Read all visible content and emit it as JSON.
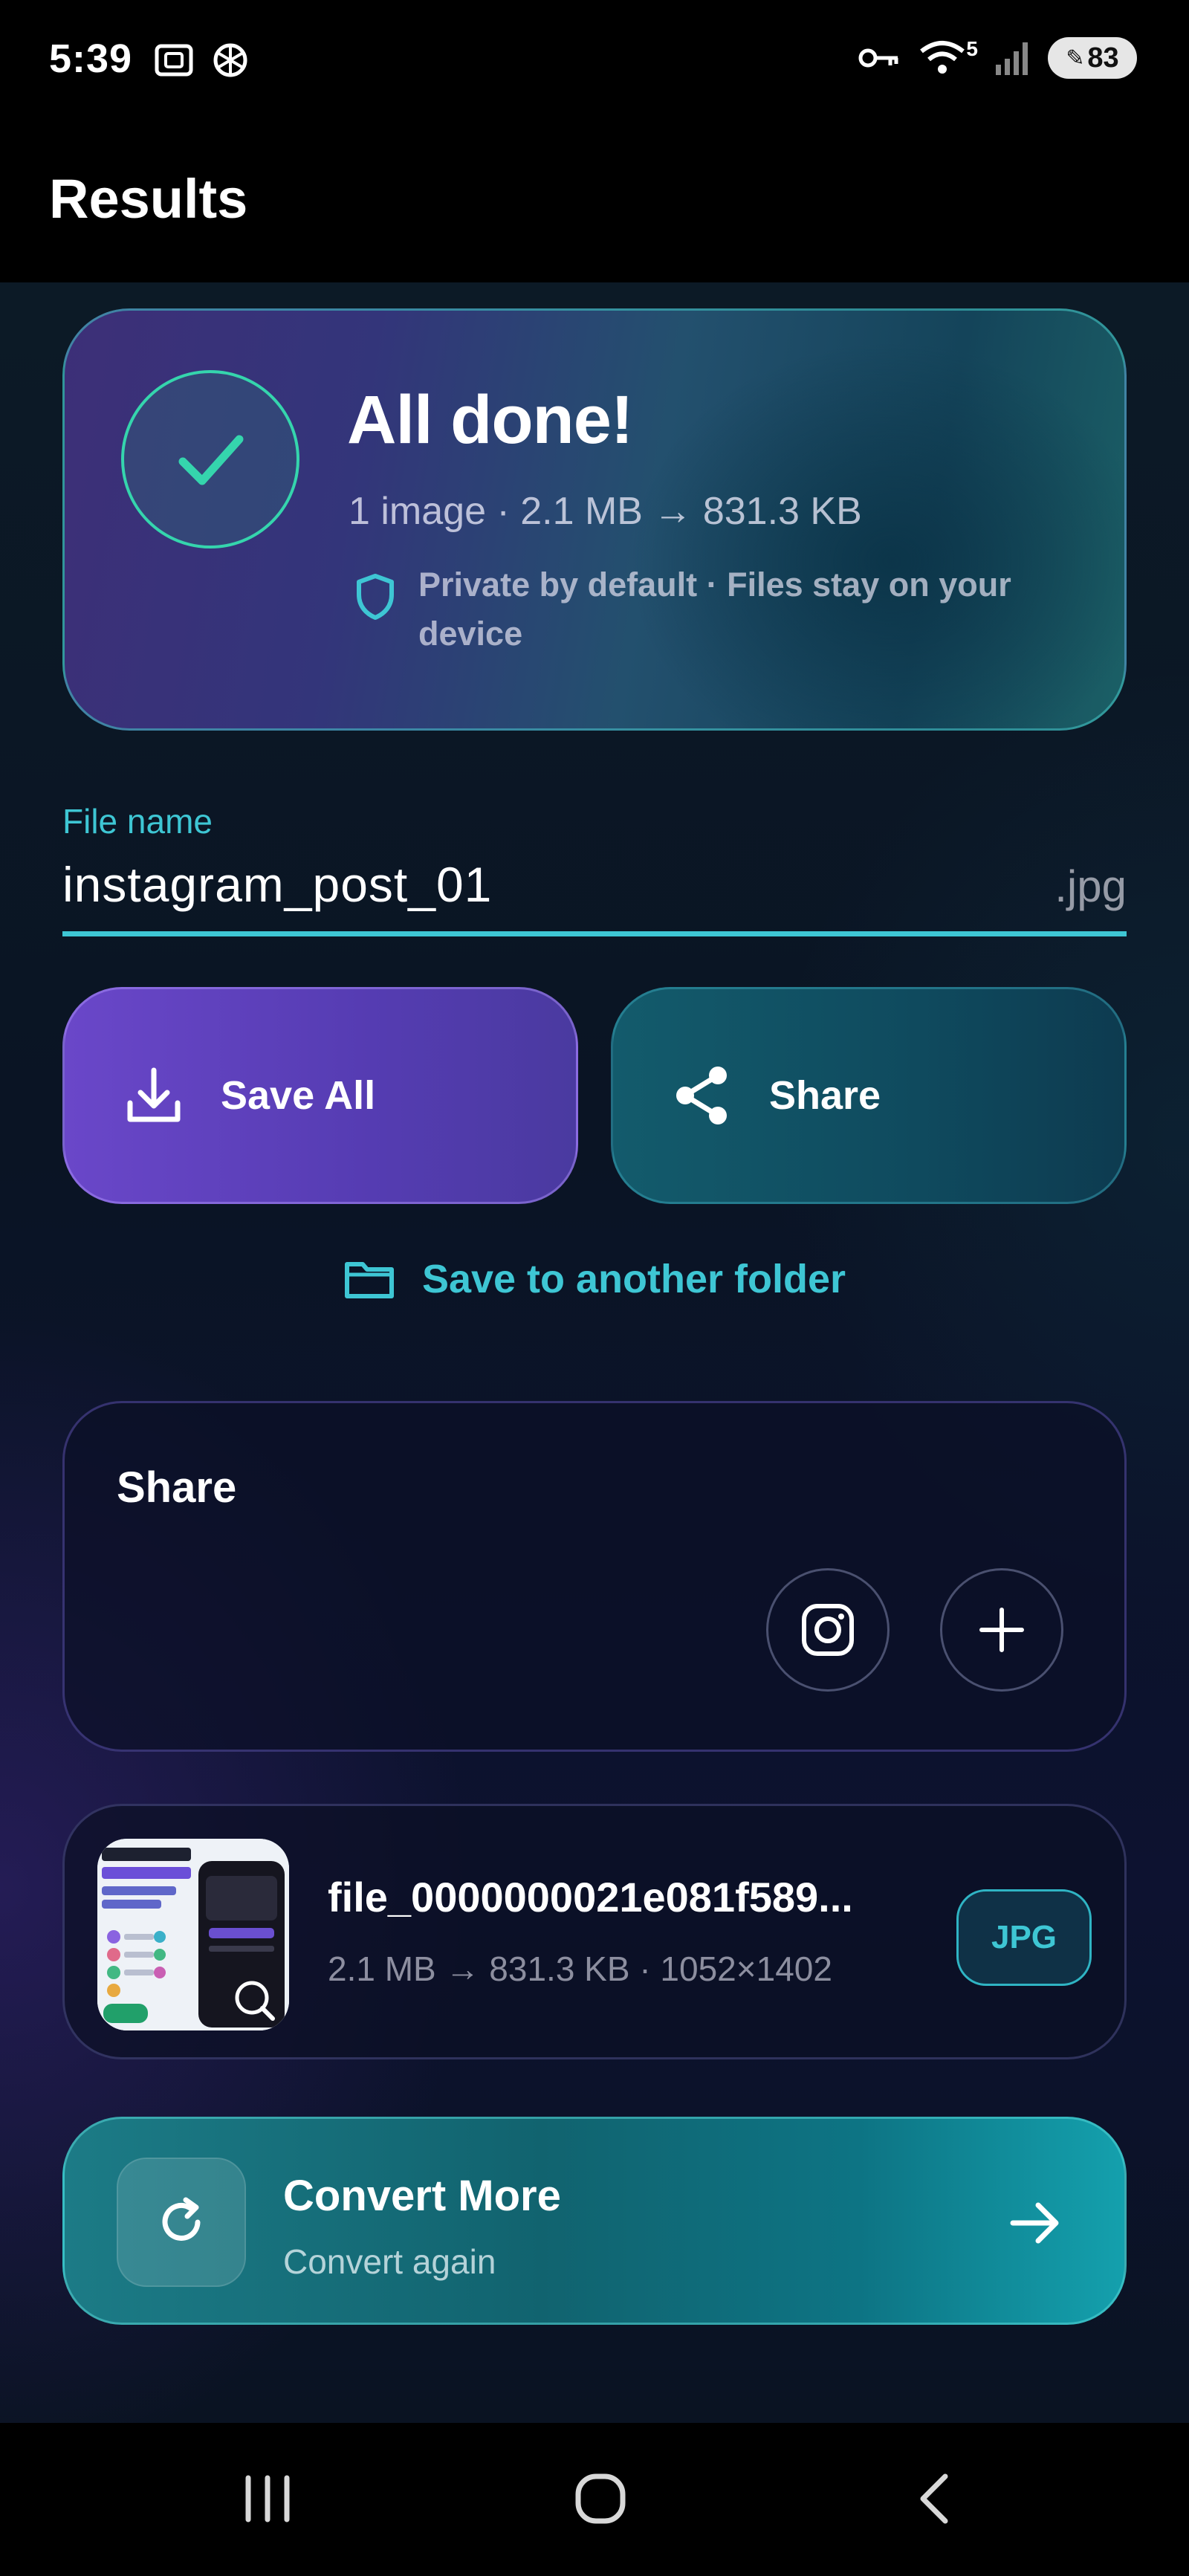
{
  "status_bar": {
    "time": "5:39",
    "battery": "83",
    "signal_superscript": "5",
    "icons": [
      "screenshot-icon",
      "openai-icon",
      "key-icon",
      "wifi-icon",
      "signal-icon",
      "battery-icon"
    ]
  },
  "app_bar": {
    "title": "Results"
  },
  "hero": {
    "title": "All done!",
    "summary": "1 image · 2.1 MB → 831.3 KB",
    "privacy": "Private by default · Files stay on your device"
  },
  "file_name_field": {
    "label": "File name",
    "value": "instagram_post_01",
    "suffix": ".jpg"
  },
  "actions": {
    "save_all": "Save All",
    "share": "Share",
    "save_to_folder": "Save to another folder"
  },
  "share_section": {
    "title": "Share",
    "targets": [
      "instagram-icon",
      "plus-icon"
    ]
  },
  "files": [
    {
      "name": "file_0000000021e081f589...",
      "meta": "2.1 MB → 831.3 KB · 1052×1402",
      "format": "JPG"
    }
  ],
  "convert_more": {
    "title": "Convert More",
    "subtitle": "Convert again"
  },
  "colors": {
    "accent_cyan": "#3ec6d4",
    "success_green": "#35d5ad",
    "save_purple": "#6a47c9",
    "share_teal": "#135b6c"
  }
}
